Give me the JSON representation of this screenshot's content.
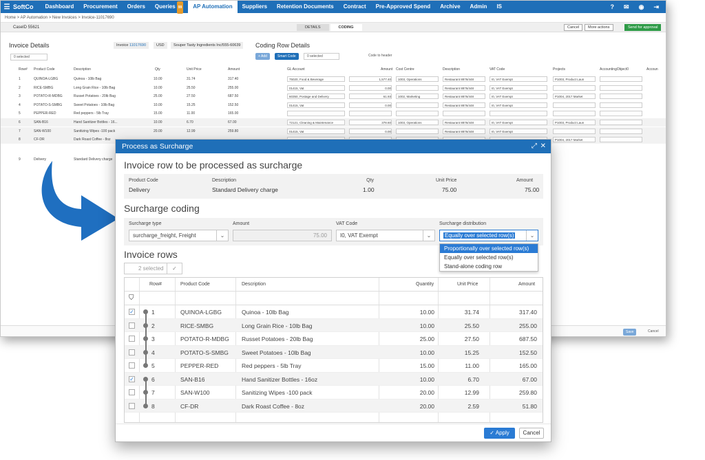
{
  "nav": {
    "logo": "SoftCo",
    "items": [
      "Dashboard",
      "Procurement",
      "Orders",
      "Queries",
      "AP Automation",
      "Suppliers",
      "Retention Documents",
      "Contract",
      "Pre-Approved Spend",
      "Archive",
      "Admin",
      "IS"
    ],
    "queries_badge": "99",
    "icons": [
      "help-icon",
      "mail-icon",
      "user-icon",
      "logout-icon"
    ]
  },
  "breadcrumb": "Home  >  AP Automation  >  New Invoices  >  Invoice-11017690",
  "toolbar": {
    "case": "CaseID 55621",
    "tabs": [
      "DETAILS",
      "CODING"
    ],
    "cancel": "Cancel",
    "more": "More actions",
    "send": "Send for approval"
  },
  "invoice_details": {
    "title": "Invoice Details",
    "chip_invoice": "Invoice",
    "invoice_no": "11017690",
    "currency": "USD",
    "supplier": "Souper Tasty Ingredients Inc/555-60639",
    "selected": "0 selected",
    "cols": [
      "Row#",
      "Product Code",
      "Description",
      "Qty",
      "Unit Price",
      "Amount"
    ],
    "rows": [
      [
        "1",
        "QUINOA-LGBG",
        "Quinoa - 10lb Bag",
        "10.00",
        "31.74",
        "317.40"
      ],
      [
        "2",
        "RICE-SMBG",
        "Long Grain Rice - 10lb Bag",
        "10.00",
        "25.50",
        "255.00"
      ],
      [
        "3",
        "POTATO-R-MDBG",
        "Russet Potatoes - 20lb Bag",
        "25.00",
        "27.50",
        "687.50"
      ],
      [
        "4",
        "POTATO-S-SMBG",
        "Sweet Potatoes - 10lb Bag",
        "10.00",
        "15.25",
        "152.50"
      ],
      [
        "5",
        "PEPPER-RED",
        "Red peppers - 5lb Tray",
        "15.00",
        "11.00",
        "165.00"
      ],
      [
        "6",
        "SAN-B16",
        "Hand Sanitizer Bottles - 16...",
        "10.00",
        "6.70",
        "67.00"
      ],
      [
        "7",
        "SAN-W100",
        "Sanitizing Wipes -100 pack",
        "20.00",
        "12.99",
        "259.80"
      ],
      [
        "8",
        "CF-DR",
        "Dark Roast Coffee - 8oz",
        "",
        "",
        ""
      ],
      [
        "9",
        "Delivery",
        "Standard Delivery charge",
        "",
        "",
        ""
      ]
    ]
  },
  "coding": {
    "title": "Coding Row Details",
    "add": "+ Add",
    "smart": "Smart Code",
    "selected": "0 selected",
    "toggle": "Code to header",
    "cols": [
      "GL Account",
      "Amount",
      "Cost Centre",
      "Description",
      "VAT Code",
      "Projects",
      "AccountingObject0",
      "Accoun"
    ],
    "rows": [
      [
        "75020, Food & Beverage",
        "1,577.40",
        "1003, Operations",
        "Restaurant 8876/448",
        "I0, VAT Exempt",
        "P1003, Product Laun"
      ],
      [
        "01415, Vat",
        "0.00",
        "",
        "Restaurant 8876/448",
        "I0, VAT Exempt",
        ""
      ],
      [
        "60350, Postage and Delivery",
        "61.93",
        "1002, Marketing",
        "Restaurant 8876/448",
        "I0, VAT Exempt",
        "P1004, 2017 Market"
      ],
      [
        "01415, Vat",
        "0.00",
        "",
        "Restaurant 8876/448",
        "I0, VAT Exempt",
        ""
      ],
      [
        "",
        "",
        "",
        "",
        "",
        ""
      ],
      [
        "72121, Cleaning & Maintenance",
        "378.60",
        "1003, Operations",
        "Restaurant 8876/448",
        "I0, VAT Exempt",
        "P1003, Product Laun"
      ],
      [
        "01415, Vat",
        "0.00",
        "",
        "Restaurant 8876/448",
        "I0, VAT Exempt",
        ""
      ],
      [
        "",
        "",
        "",
        "",
        "",
        "P1004, 2017 Market"
      ]
    ]
  },
  "bg_footer": {
    "save": "Save",
    "cancel": "Cancel"
  },
  "modal": {
    "title": "Process as Surcharge",
    "section1": "Invoice row to be processed as surcharge",
    "row": {
      "labels": [
        "Product Code",
        "Description",
        "Qty",
        "Unit Price",
        "Amount"
      ],
      "values": [
        "Delivery",
        "Standard Delivery charge",
        "1.00",
        "75.00",
        "75.00"
      ]
    },
    "section2": "Surcharge coding",
    "coding": {
      "type_label": "Surcharge type",
      "type_value": "surcharge_freight, Freight",
      "amount_label": "Amount",
      "amount_value": "75.00",
      "vat_label": "VAT Code",
      "vat_value": "I0, VAT Exempt",
      "dist_label": "Surcharge distribution",
      "dist_value": "Equally over selected row(s)",
      "dist_options": [
        "Proportionally over selected row(s)",
        "Equally over selected row(s)",
        "Stand-alone coding row"
      ]
    },
    "section3": "Invoice rows",
    "selected": "2 selected",
    "grid": {
      "cols": [
        "Row#",
        "Product Code",
        "Description",
        "Quantity",
        "Unit Price",
        "Amount"
      ],
      "rows": [
        {
          "checked": true,
          "row": "1",
          "code": "QUINOA-LGBG",
          "desc": "Quinoa - 10lb Bag",
          "qty": "10.00",
          "price": "31.74",
          "amount": "317.40"
        },
        {
          "checked": false,
          "row": "2",
          "code": "RICE-SMBG",
          "desc": "Long Grain Rice - 10lb Bag",
          "qty": "10.00",
          "price": "25.50",
          "amount": "255.00"
        },
        {
          "checked": false,
          "row": "3",
          "code": "POTATO-R-MDBG",
          "desc": "Russet Potatoes - 20lb Bag",
          "qty": "25.00",
          "price": "27.50",
          "amount": "687.50"
        },
        {
          "checked": false,
          "row": "4",
          "code": "POTATO-S-SMBG",
          "desc": "Sweet Potatoes - 10lb Bag",
          "qty": "10.00",
          "price": "15.25",
          "amount": "152.50"
        },
        {
          "checked": false,
          "row": "5",
          "code": "PEPPER-RED",
          "desc": "Red peppers - 5lb Tray",
          "qty": "15.00",
          "price": "11.00",
          "amount": "165.00"
        },
        {
          "checked": true,
          "row": "6",
          "code": "SAN-B16",
          "desc": "Hand Sanitizer Bottles - 16oz",
          "qty": "10.00",
          "price": "6.70",
          "amount": "67.00"
        },
        {
          "checked": false,
          "row": "7",
          "code": "SAN-W100",
          "desc": "Sanitizing Wipes -100 pack",
          "qty": "20.00",
          "price": "12.99",
          "amount": "259.80"
        },
        {
          "checked": false,
          "row": "8",
          "code": "CF-DR",
          "desc": "Dark Roast Coffee - 8oz",
          "qty": "20.00",
          "price": "2.59",
          "amount": "51.80"
        }
      ]
    },
    "apply": "Apply",
    "cancel": "Cancel"
  }
}
